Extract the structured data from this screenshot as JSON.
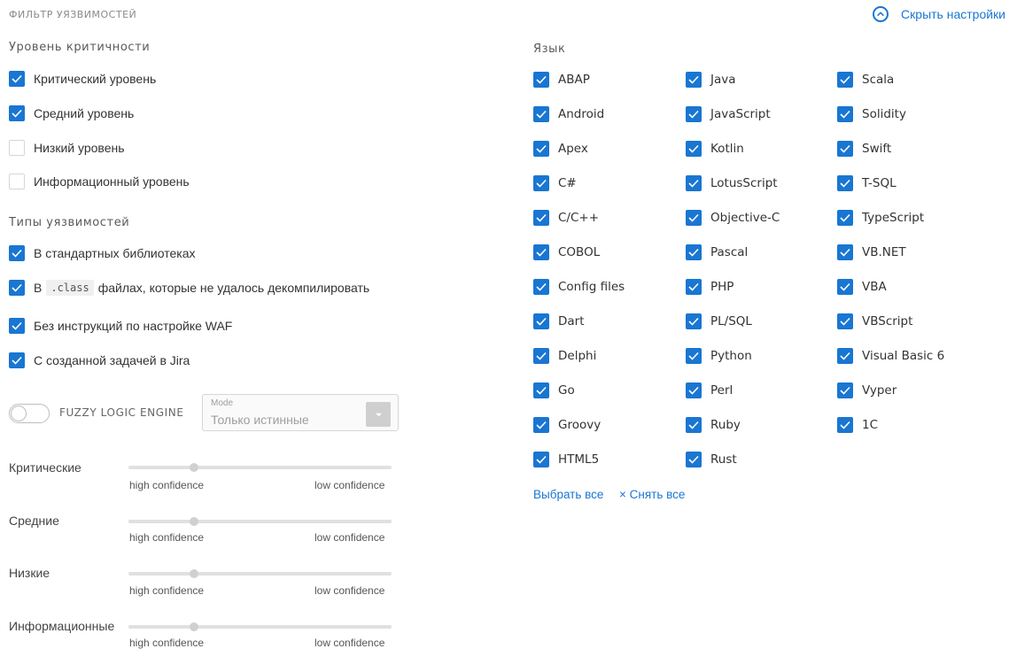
{
  "header": {
    "title": "ФИЛЬТР УЯЗВИМОСТЕЙ",
    "hide_settings_label": "Скрыть настройки"
  },
  "severity": {
    "label": "Уровень критичности",
    "items": [
      {
        "label": "Критический уровень",
        "checked": true
      },
      {
        "label": "Средний уровень",
        "checked": true
      },
      {
        "label": "Низкий уровень",
        "checked": false
      },
      {
        "label": "Информационный уровень",
        "checked": false
      }
    ]
  },
  "vuln_types": {
    "label": "Типы уязвимостей",
    "items": [
      {
        "label": "В стандартных библиотеках",
        "checked": true
      },
      {
        "prefix": "В",
        "code": ".class",
        "suffix": "файлах, которые не удалось декомпилировать",
        "checked": true
      },
      {
        "label": "Без инструкций по настройке WAF",
        "checked": true
      },
      {
        "label": "С созданной задачей в Jira",
        "checked": true
      }
    ]
  },
  "fuzzy": {
    "label": "FUZZY LOGIC ENGINE",
    "enabled": false,
    "mode_label": "Mode",
    "mode_value": "Только истинные"
  },
  "confidence_sliders": [
    {
      "label": "Критические",
      "left": "high confidence",
      "right": "low confidence",
      "position": 0.25
    },
    {
      "label": "Средние",
      "left": "high confidence",
      "right": "low confidence",
      "position": 0.25
    },
    {
      "label": "Низкие",
      "left": "high confidence",
      "right": "low confidence",
      "position": 0.25
    },
    {
      "label": "Информационные",
      "left": "high confidence",
      "right": "low confidence",
      "position": 0.25
    }
  ],
  "language": {
    "label": "Язык",
    "columns": [
      [
        "ABAP",
        "Android",
        "Apex",
        "C#",
        "C/C++",
        "COBOL",
        "Config files",
        "Dart",
        "Delphi",
        "Go",
        "Groovy",
        "HTML5"
      ],
      [
        "Java",
        "JavaScript",
        "Kotlin",
        "LotusScript",
        "Objective-C",
        "Pascal",
        "PHP",
        "PL/SQL",
        "Python",
        "Perl",
        "Ruby",
        "Rust"
      ],
      [
        "Scala",
        "Solidity",
        "Swift",
        "T-SQL",
        "TypeScript",
        "VB.NET",
        "VBA",
        "VBScript",
        "Visual Basic 6",
        "Vyper",
        "1C"
      ]
    ],
    "select_all": "Выбрать все",
    "clear_all": "× Снять все"
  },
  "colors": {
    "accent": "#1976d2",
    "checkbox_off_border": "#d6d6d6"
  }
}
